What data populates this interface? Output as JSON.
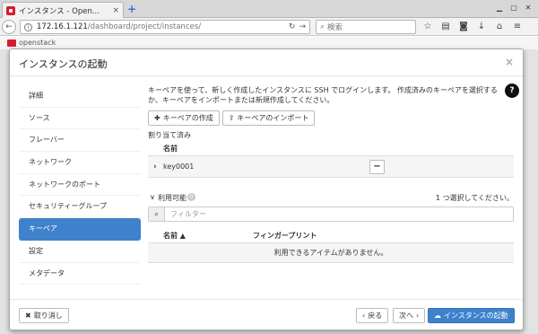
{
  "browser": {
    "tab_title": "インスタンス - Open...",
    "tab_close": "×",
    "new_tab": "+",
    "url_host": "172.16.1.121",
    "url_path": "/dashboard/project/instances/",
    "search_placeholder": "検索"
  },
  "background": {
    "brand": "openstack"
  },
  "modal": {
    "title": "インスタンスの起動",
    "close": "×",
    "nav_items": [
      {
        "label": "詳細"
      },
      {
        "label": "ソース"
      },
      {
        "label": "フレーバー"
      },
      {
        "label": "ネットワーク"
      },
      {
        "label": "ネットワークのポート"
      },
      {
        "label": "セキュリティーグループ"
      },
      {
        "label": "キーペア"
      },
      {
        "label": "設定"
      },
      {
        "label": "メタデータ"
      }
    ],
    "active_nav_index": 6,
    "help": "?",
    "description": "キーペアを使って、新しく作成したインスタンスに SSH でログインします。 作成済みのキーペアを選択するか、キーペアをインポートまたは新規作成してください。",
    "create_keypair_label": "キーペアの作成",
    "import_keypair_label": "キーペアのインポート",
    "allocated": {
      "label": "割り当て済み",
      "column_name": "名前",
      "rows": [
        {
          "name": "key0001"
        }
      ],
      "remove_label": "−"
    },
    "available": {
      "label": "利用可能",
      "count": "0",
      "select_hint": "1 つ選択してください。",
      "filter_placeholder": "フィルター",
      "columns": {
        "name": "名前 ▲",
        "fingerprint": "フィンガープリント"
      },
      "empty_message": "利用できるアイテムがありません。"
    },
    "footer": {
      "cancel_label": "取り消し",
      "back_label": "戻る",
      "next_label": "次へ",
      "launch_label": "インスタンスの起動"
    }
  }
}
